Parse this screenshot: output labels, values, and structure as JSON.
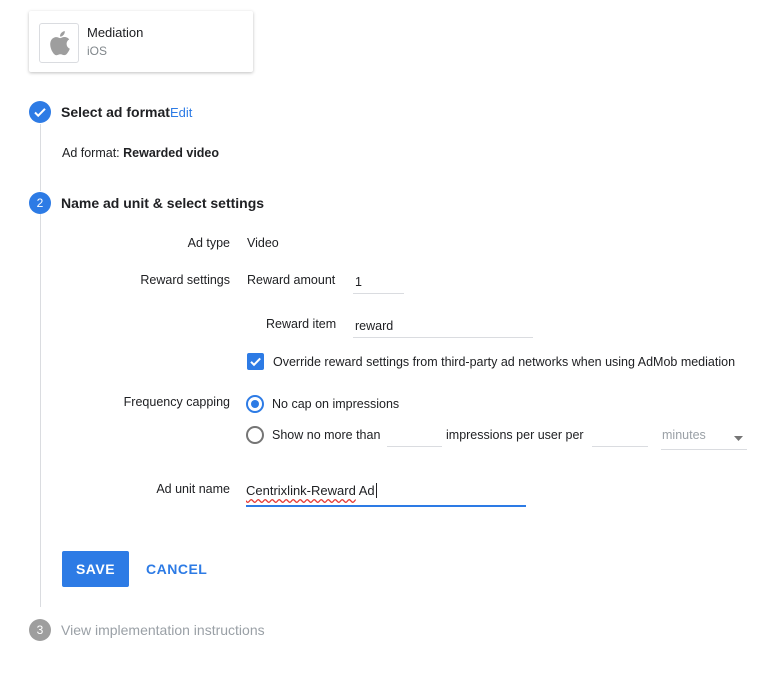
{
  "app": {
    "name": "Mediation",
    "platform": "iOS",
    "icon": "apple-icon"
  },
  "steps": [
    {
      "number": "✓",
      "title": "Select ad format",
      "action": "Edit",
      "summary_label": "Ad format:",
      "summary_value": "Rewarded video"
    },
    {
      "number": "2",
      "title": "Name ad unit & select settings"
    },
    {
      "number": "3",
      "title": "View implementation instructions"
    }
  ],
  "settings": {
    "ad_type": {
      "label": "Ad type",
      "value": "Video"
    },
    "reward": {
      "label": "Reward settings",
      "amount_label": "Reward amount",
      "amount_value": "1",
      "item_label": "Reward item",
      "item_value": "reward",
      "override_text": "Override reward settings from third-party ad networks when using AdMob mediation",
      "override_checked": true
    },
    "frequency": {
      "label": "Frequency capping",
      "option_none": "No cap on impressions",
      "option_limit_prefix": "Show no more than",
      "option_limit_middle": "impressions per user per",
      "unit_select": "minutes",
      "selected": "none"
    },
    "ad_unit_name": {
      "label": "Ad unit name",
      "value_misspelled": "Centrixlink-Reward",
      "value_rest": " Ad"
    }
  },
  "buttons": {
    "save": "SAVE",
    "cancel": "CANCEL"
  },
  "colors": {
    "accent": "#2d7be5",
    "muted": "#9e9e9e"
  }
}
